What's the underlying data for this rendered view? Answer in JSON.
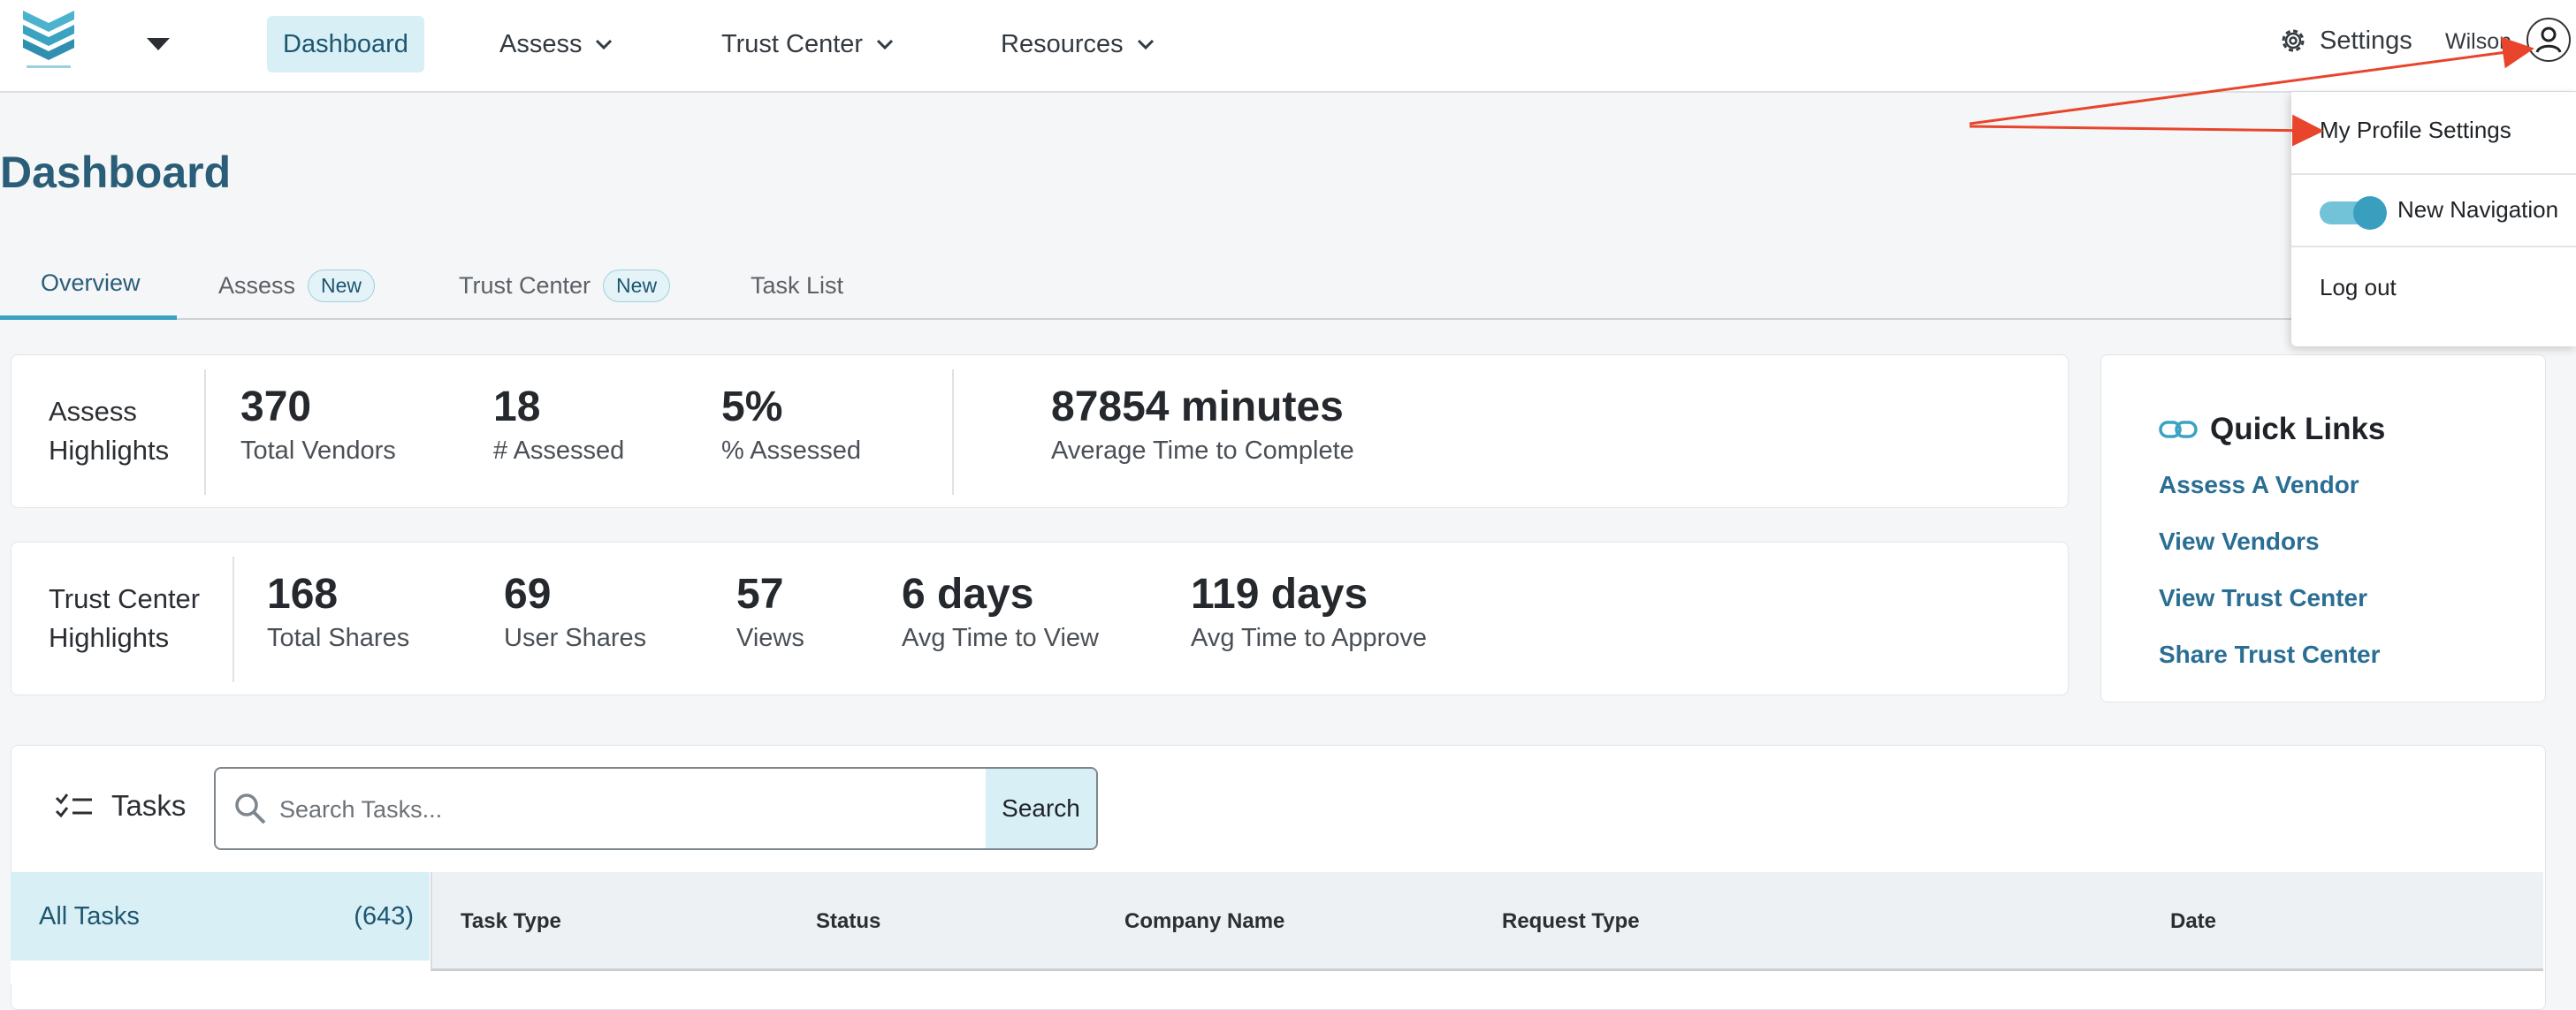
{
  "nav": {
    "items": [
      {
        "label": "Dashboard"
      },
      {
        "label": "Assess"
      },
      {
        "label": "Trust Center"
      },
      {
        "label": "Resources"
      }
    ],
    "settings_label": "Settings",
    "username": "Wilson",
    "icons": {
      "settings": "gear-icon",
      "user": "user-circle-icon",
      "caret": "caret-down-icon",
      "chevron": "chevron-down-icon"
    }
  },
  "page": {
    "title": "Dashboard"
  },
  "tabs": [
    {
      "label": "Overview"
    },
    {
      "label": "Assess",
      "badge": "New"
    },
    {
      "label": "Trust Center",
      "badge": "New"
    },
    {
      "label": "Task List"
    }
  ],
  "assess_highlights": {
    "label_line1": "Assess",
    "label_line2": "Highlights",
    "metrics": [
      {
        "value": "370",
        "label": "Total Vendors"
      },
      {
        "value": "18",
        "label": "# Assessed"
      },
      {
        "value": "5%",
        "label": "% Assessed"
      },
      {
        "value": "87854 minutes",
        "label": "Average Time to Complete"
      }
    ]
  },
  "trust_highlights": {
    "label_line1": "Trust Center",
    "label_line2": "Highlights",
    "metrics": [
      {
        "value": "168",
        "label": "Total Shares"
      },
      {
        "value": "69",
        "label": "User Shares"
      },
      {
        "value": "57",
        "label": "Views"
      },
      {
        "value": "6 days",
        "label": "Avg Time to View"
      },
      {
        "value": "119 days",
        "label": "Avg Time to Approve"
      }
    ]
  },
  "quick_links": {
    "title": "Quick Links",
    "links": [
      "Assess A Vendor",
      "View Vendors",
      "View Trust Center",
      "Share Trust Center"
    ]
  },
  "tasks": {
    "title": "Tasks",
    "search_placeholder": "Search Tasks...",
    "search_button": "Search",
    "filters": [
      {
        "label": "All Tasks",
        "count": "(643)"
      }
    ],
    "columns": [
      "Task Type",
      "Status",
      "Company Name",
      "Request Type",
      "Date"
    ]
  },
  "profile_menu": {
    "items": [
      "My Profile Settings",
      "New Navigation",
      "Log out"
    ],
    "new_navigation_enabled": true
  },
  "colors": {
    "accent": "#3aa3c2",
    "title": "#2a5e78",
    "link": "#2a6e94",
    "highlight_bg": "#d7eff5",
    "annotation_arrow": "#e8452c"
  }
}
